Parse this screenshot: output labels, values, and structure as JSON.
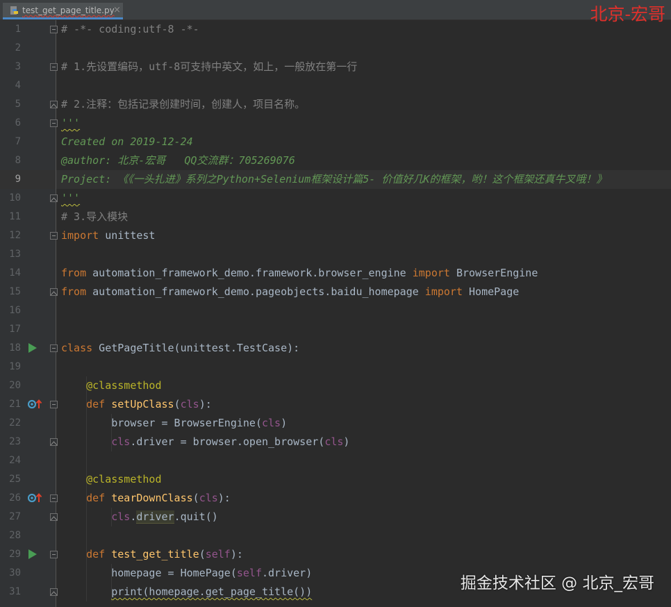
{
  "tab": {
    "filename": "test_get_page_title.py",
    "close_glyph": "×",
    "icon": "python-file-icon"
  },
  "watermark_top": "北京-宏哥",
  "watermark_bottom": "掘金技术社区 @ 北京_宏哥",
  "colors": {
    "comment": "#808080",
    "docstring": "#629755",
    "keyword": "#cc7832",
    "decorator": "#bbb529",
    "function": "#ffc66d",
    "self": "#94558d",
    "plain": "#a9b7c6",
    "run_icon": "#499c54",
    "override_icon": "#4a9cc7"
  },
  "current_line": 9,
  "lines": [
    {
      "n": "1",
      "tokens": [
        {
          "t": "# -*- coding:utf-8 -*-",
          "c": "comment"
        }
      ]
    },
    {
      "n": "2",
      "tokens": []
    },
    {
      "n": "3",
      "tokens": [
        {
          "t": "# 1.先设置编码，utf-8可支持中英文，如上，一般放在第一行",
          "c": "comment"
        }
      ]
    },
    {
      "n": "4",
      "tokens": []
    },
    {
      "n": "5",
      "tokens": [
        {
          "t": "# 2.注释：包括记录创建时间，创建人，项目名称。",
          "c": "comment"
        }
      ]
    },
    {
      "n": "6",
      "tokens": [
        {
          "t": "'''",
          "c": "doc",
          "sq": true
        }
      ]
    },
    {
      "n": "7",
      "tokens": [
        {
          "t": "Created on 2019-12-24",
          "c": "doc"
        }
      ]
    },
    {
      "n": "8",
      "tokens": [
        {
          "t": "@author: 北京-宏哥   QQ交流群：705269076",
          "c": "doc"
        }
      ]
    },
    {
      "n": "9",
      "tokens": [
        {
          "t": "Project: 《《一头扎进》系列之Python+Selenium框架设计篇5- 价值好几K的框架，哟！这个框架还真牛叉哦！》",
          "c": "doc"
        }
      ]
    },
    {
      "n": "10",
      "tokens": [
        {
          "t": "'''",
          "c": "doc",
          "sq": true
        }
      ]
    },
    {
      "n": "11",
      "tokens": [
        {
          "t": "# 3.导入模块",
          "c": "comment"
        }
      ]
    },
    {
      "n": "12",
      "tokens": [
        {
          "t": "import",
          "c": "kw"
        },
        {
          "t": " unittest",
          "c": "plain"
        }
      ]
    },
    {
      "n": "13",
      "tokens": []
    },
    {
      "n": "14",
      "tokens": [
        {
          "t": "from",
          "c": "kw"
        },
        {
          "t": " automation_framework_demo.framework.browser_engine ",
          "c": "plain"
        },
        {
          "t": "import",
          "c": "kw"
        },
        {
          "t": " BrowserEngine",
          "c": "plain"
        }
      ]
    },
    {
      "n": "15",
      "tokens": [
        {
          "t": "from",
          "c": "kw"
        },
        {
          "t": " automation_framework_demo.pageobjects.baidu_homepage ",
          "c": "plain"
        },
        {
          "t": "import",
          "c": "kw"
        },
        {
          "t": " HomePage",
          "c": "plain"
        }
      ]
    },
    {
      "n": "16",
      "tokens": []
    },
    {
      "n": "17",
      "tokens": []
    },
    {
      "n": "18",
      "tokens": [
        {
          "t": "class",
          "c": "kw"
        },
        {
          "t": " GetPageTitle(unittest.TestCase):",
          "c": "plain"
        }
      ]
    },
    {
      "n": "19",
      "tokens": []
    },
    {
      "n": "20",
      "tokens": [
        {
          "t": "    ",
          "c": "plain"
        },
        {
          "t": "@classmethod",
          "c": "dec"
        }
      ]
    },
    {
      "n": "21",
      "tokens": [
        {
          "t": "    ",
          "c": "plain"
        },
        {
          "t": "def",
          "c": "kw"
        },
        {
          "t": " ",
          "c": "plain"
        },
        {
          "t": "setUpClass",
          "c": "func"
        },
        {
          "t": "(",
          "c": "plain"
        },
        {
          "t": "cls",
          "c": "self"
        },
        {
          "t": "):",
          "c": "plain"
        }
      ]
    },
    {
      "n": "22",
      "tokens": [
        {
          "t": "        browser = BrowserEngine(",
          "c": "plain"
        },
        {
          "t": "cls",
          "c": "self"
        },
        {
          "t": ")",
          "c": "plain"
        }
      ]
    },
    {
      "n": "23",
      "tokens": [
        {
          "t": "        ",
          "c": "plain"
        },
        {
          "t": "cls",
          "c": "self"
        },
        {
          "t": ".driver = browser.open_browser(",
          "c": "plain"
        },
        {
          "t": "cls",
          "c": "self"
        },
        {
          "t": ")",
          "c": "plain"
        }
      ]
    },
    {
      "n": "24",
      "tokens": []
    },
    {
      "n": "25",
      "tokens": [
        {
          "t": "    ",
          "c": "plain"
        },
        {
          "t": "@classmethod",
          "c": "dec"
        }
      ]
    },
    {
      "n": "26",
      "tokens": [
        {
          "t": "    ",
          "c": "plain"
        },
        {
          "t": "def",
          "c": "kw"
        },
        {
          "t": " ",
          "c": "plain"
        },
        {
          "t": "tearDownClass",
          "c": "func"
        },
        {
          "t": "(",
          "c": "plain"
        },
        {
          "t": "cls",
          "c": "self"
        },
        {
          "t": "):",
          "c": "plain"
        }
      ]
    },
    {
      "n": "27",
      "tokens": [
        {
          "t": "        ",
          "c": "plain"
        },
        {
          "t": "cls",
          "c": "self"
        },
        {
          "t": ".",
          "c": "plain"
        },
        {
          "t": "driver",
          "c": "plain",
          "hl": true
        },
        {
          "t": ".quit()",
          "c": "plain"
        }
      ]
    },
    {
      "n": "28",
      "tokens": []
    },
    {
      "n": "29",
      "tokens": [
        {
          "t": "    ",
          "c": "plain"
        },
        {
          "t": "def",
          "c": "kw"
        },
        {
          "t": " ",
          "c": "plain"
        },
        {
          "t": "test_get_title",
          "c": "func"
        },
        {
          "t": "(",
          "c": "plain"
        },
        {
          "t": "self",
          "c": "self"
        },
        {
          "t": "):",
          "c": "plain"
        }
      ]
    },
    {
      "n": "30",
      "tokens": [
        {
          "t": "        homepage = HomePage(",
          "c": "plain"
        },
        {
          "t": "self",
          "c": "self"
        },
        {
          "t": ".driver)",
          "c": "plain"
        }
      ]
    },
    {
      "n": "31",
      "tokens": [
        {
          "t": "        ",
          "c": "plain"
        },
        {
          "t": "print(homepage.get_page_title())",
          "c": "plain",
          "sq": true
        }
      ]
    }
  ],
  "gutter_markers": {
    "fold_open": [
      "1",
      "3",
      "6",
      "12",
      "18",
      "21"
    ],
    "fold_close": [
      "5",
      "10",
      "15",
      "23",
      "27",
      "31"
    ],
    "fold_method": [
      "26",
      "29"
    ],
    "run": [
      "18",
      "29"
    ],
    "override": [
      "21",
      "26"
    ]
  }
}
